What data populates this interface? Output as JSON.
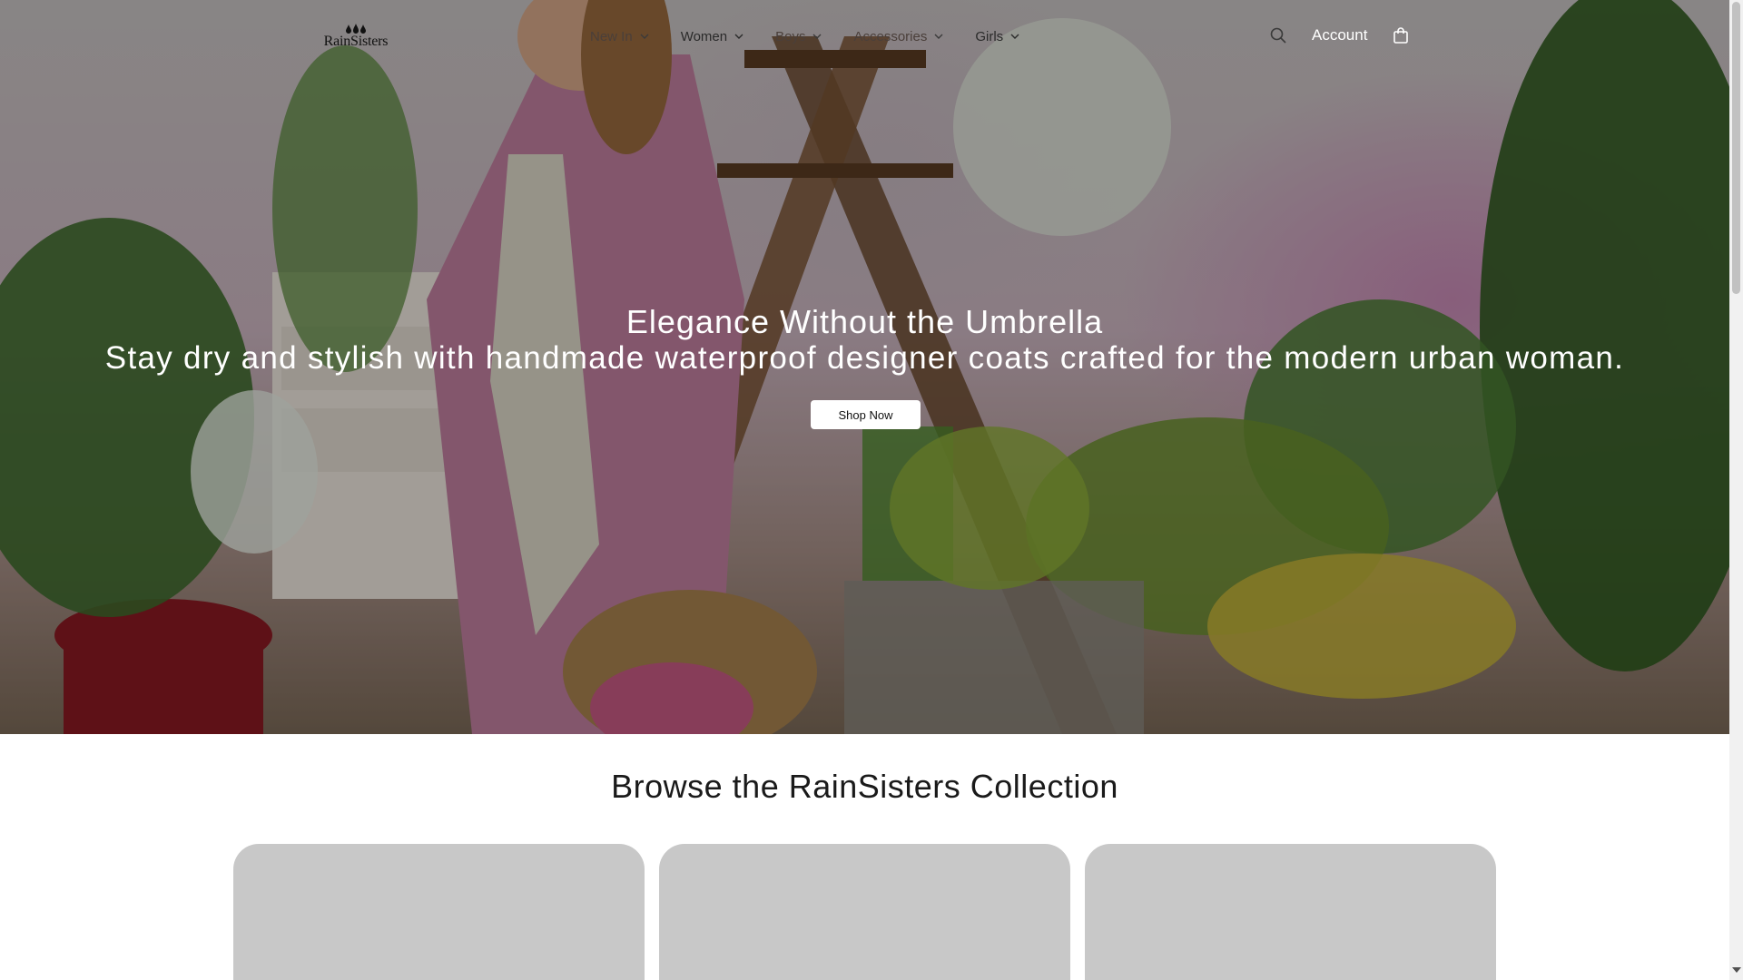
{
  "brand": {
    "name": "RainSisters"
  },
  "nav": {
    "items": [
      {
        "label": "New In",
        "has_dropdown": true
      },
      {
        "label": "Women",
        "has_dropdown": true
      },
      {
        "label": "Boys",
        "has_dropdown": true
      },
      {
        "label": "Accessories",
        "has_dropdown": true
      },
      {
        "label": "Girls",
        "has_dropdown": true
      }
    ],
    "account_label": "Account",
    "search_icon": "search-icon",
    "bag_icon": "shopping-bag-icon"
  },
  "hero": {
    "title": "Elegance Without the Umbrella",
    "subtitle": "Stay dry and stylish with handmade waterproof designer coats crafted for the modern urban woman.",
    "cta_label": "Shop Now"
  },
  "collection": {
    "title": "Browse the RainSisters Collection",
    "card_count": 3
  },
  "colors": {
    "overlay": "#000000",
    "card_placeholder": "#c8c8c8",
    "hero_text": "#ffffff"
  }
}
